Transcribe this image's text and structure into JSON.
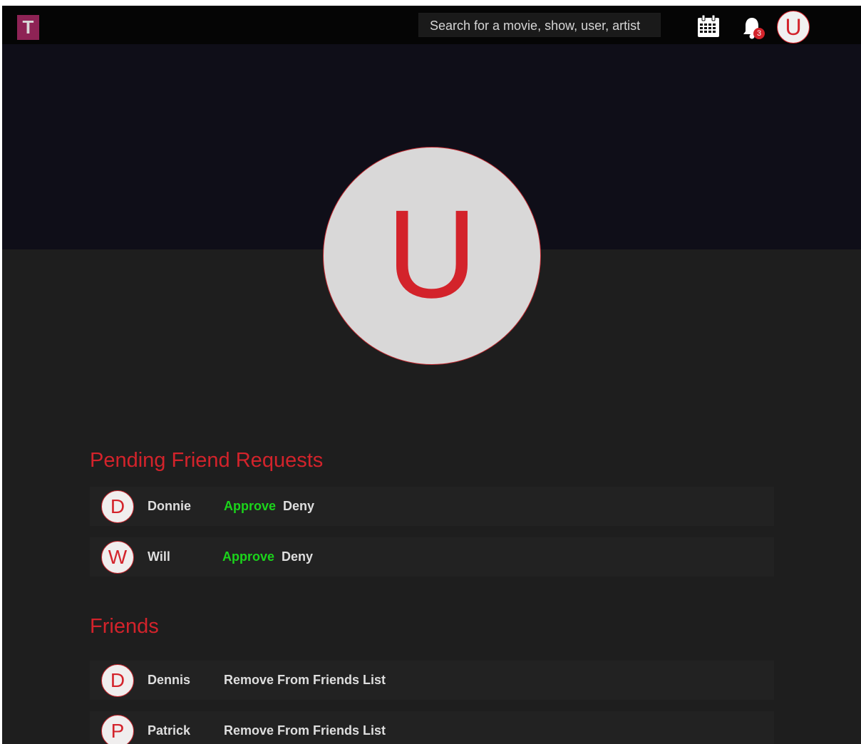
{
  "navbar": {
    "logo_letter": "T",
    "search_placeholder": "Search for a movie, show, user, artist",
    "calendar_icon": "calendar-icon",
    "bell_icon": "bell-icon",
    "notification_count": "3",
    "user_initial": "U"
  },
  "profile": {
    "initial": "U"
  },
  "pending": {
    "title": "Pending Friend Requests",
    "requests": [
      {
        "initial": "D",
        "name": "Donnie",
        "approve": "Approve",
        "deny": "Deny"
      },
      {
        "initial": "W",
        "name": "Will",
        "approve": "Approve",
        "deny": "Deny"
      }
    ]
  },
  "friends": {
    "title": "Friends",
    "list": [
      {
        "initial": "D",
        "name": "Dennis",
        "remove": "Remove From Friends List"
      },
      {
        "initial": "P",
        "name": "Patrick",
        "remove": "Remove From Friends List"
      }
    ]
  },
  "colors": {
    "accent": "#d3232b",
    "approve": "#1bd41b",
    "logo_bg": "#8e2355",
    "banner": "#0f0e18",
    "background": "#1e1e1e"
  }
}
